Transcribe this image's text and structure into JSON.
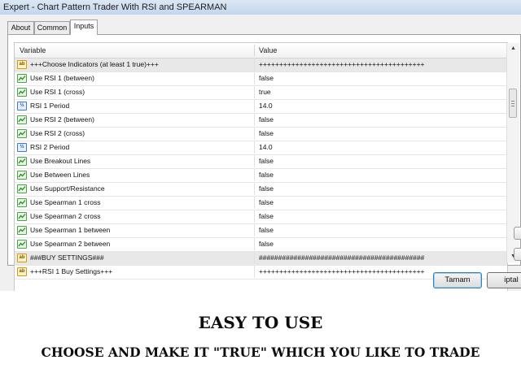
{
  "window": {
    "title": "Expert - Chart Pattern Trader With RSI and SPEARMAN"
  },
  "tabs": [
    {
      "label": "About",
      "active": false
    },
    {
      "label": "Common",
      "active": false
    },
    {
      "label": "Inputs",
      "active": true
    }
  ],
  "grid": {
    "headers": {
      "variable": "Variable",
      "value": "Value"
    },
    "rows": [
      {
        "icon": "string-icon",
        "name": "+++Choose Indicators (at least 1 true)+++",
        "value": "+++++++++++++++++++++++++++++++++++++++++",
        "section": true
      },
      {
        "icon": "bool-icon",
        "name": "Use RSI 1 (between)",
        "value": "false"
      },
      {
        "icon": "bool-icon",
        "name": "Use RSI 1 (cross)",
        "value": "true"
      },
      {
        "icon": "number-icon",
        "name": "RSI 1 Period",
        "value": "14.0"
      },
      {
        "icon": "bool-icon",
        "name": "Use RSI 2 (between)",
        "value": "false"
      },
      {
        "icon": "bool-icon",
        "name": "Use RSI 2 (cross)",
        "value": "false"
      },
      {
        "icon": "number-icon",
        "name": "RSI 2 Period",
        "value": "14.0"
      },
      {
        "icon": "bool-icon",
        "name": "Use Breakout Lines",
        "value": "false"
      },
      {
        "icon": "bool-icon",
        "name": "Use Between Lines",
        "value": "false"
      },
      {
        "icon": "bool-icon",
        "name": "Use Support/Resistance",
        "value": "false"
      },
      {
        "icon": "bool-icon",
        "name": "Use Spearman 1 cross",
        "value": "false"
      },
      {
        "icon": "bool-icon",
        "name": "Use Spearman 2 cross",
        "value": "false"
      },
      {
        "icon": "bool-icon",
        "name": "Use Spearman 1 between",
        "value": "false"
      },
      {
        "icon": "bool-icon",
        "name": "Use Spearman 2 between",
        "value": "false"
      },
      {
        "icon": "string-icon",
        "name": "###BUY SETTINGS###",
        "value": "###########################################",
        "section": true
      },
      {
        "icon": "string-icon",
        "name": "+++RSI 1 Buy Settings+++",
        "value": "+++++++++++++++++++++++++++++++++++++++++"
      }
    ]
  },
  "buttons": {
    "ok": "Tamam",
    "cancel": "iptal"
  },
  "captions": {
    "headline": "EASY TO USE",
    "subline": "CHOOSE AND MAKE IT \"TRUE\" WHICH YOU LIKE TO TRADE"
  },
  "icon_badges": {
    "number": "½",
    "string": "ab"
  }
}
